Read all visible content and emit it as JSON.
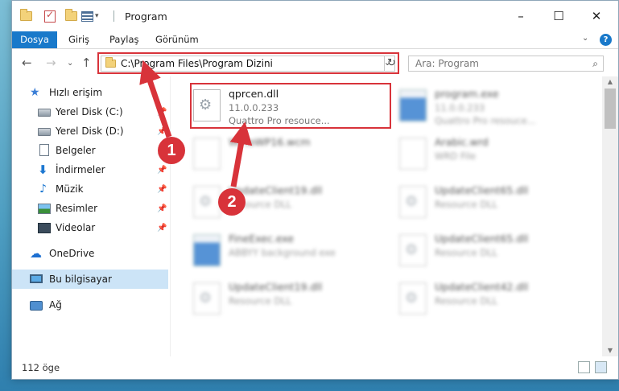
{
  "window": {
    "title": "Program",
    "min_label": "–",
    "max_label": "☐",
    "close_label": "✕"
  },
  "ribbon": {
    "tabs": [
      "Dosya",
      "Giriş",
      "Paylaş",
      "Görünüm"
    ],
    "expand_glyph": "⌄",
    "help_glyph": "?"
  },
  "nav": {
    "back_glyph": "←",
    "forward_glyph": "→",
    "dropdown_glyph": "⌄",
    "up_glyph": "↑",
    "address": "C:\\Program Files\\Program Dizini",
    "address_dropdown_glyph": "⌄",
    "refresh_glyph": "↻",
    "search_placeholder": "Ara: Program",
    "search_glyph": "⌕"
  },
  "sidebar": {
    "items": [
      {
        "label": "Hızlı erişim",
        "icon": "star-icon"
      },
      {
        "label": "Yerel Disk (C:)",
        "icon": "drive-icon"
      },
      {
        "label": "Yerel Disk (D:)",
        "icon": "drive-icon"
      },
      {
        "label": "Belgeler",
        "icon": "document-icon"
      },
      {
        "label": "İndirmeler",
        "icon": "download-icon"
      },
      {
        "label": "Müzik",
        "icon": "music-icon"
      },
      {
        "label": "Resimler",
        "icon": "pictures-icon"
      },
      {
        "label": "Videolar",
        "icon": "videos-icon"
      },
      {
        "label": "OneDrive",
        "icon": "cloud-icon"
      },
      {
        "label": "Bu bilgisayar",
        "icon": "computer-icon"
      },
      {
        "label": "Ağ",
        "icon": "network-icon"
      }
    ],
    "pin_glyph": "📌"
  },
  "files": [
    {
      "name": "qprcen.dll",
      "line2": "11.0.0.233",
      "line3": "Quattro Pro resouce..."
    },
    {
      "name": "program.exe",
      "line2": "11.0.0.233",
      "line3": "Quattro Pro resouce..."
    },
    {
      "name": "WPtoWP16.wcm",
      "line2": "",
      "line3": ""
    },
    {
      "name": "Arabic.wrd",
      "line2": "WRD File",
      "line3": ""
    },
    {
      "name": "UpdateClient19.dll",
      "line2": "Resource DLL",
      "line3": ""
    },
    {
      "name": "UpdateClient65.dll",
      "line2": "Resource DLL",
      "line3": ""
    },
    {
      "name": "FineExec.exe",
      "line2": "ABBYY background exe",
      "line3": ""
    },
    {
      "name": "UpdateClient65.dll",
      "line2": "Resource DLL",
      "line3": ""
    },
    {
      "name": "UpdateClient19.dll",
      "line2": "Resource DLL",
      "line3": ""
    },
    {
      "name": "UpdateClient42.dll",
      "line2": "Resource DLL",
      "line3": ""
    }
  ],
  "status": {
    "count": "112 öge"
  },
  "annotations": {
    "badge1": "1",
    "badge2": "2",
    "color": "#d8333a"
  }
}
